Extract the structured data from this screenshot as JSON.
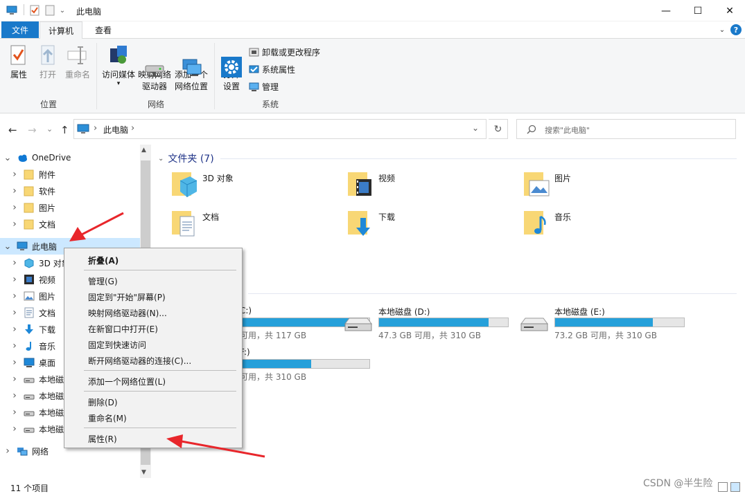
{
  "window": {
    "title": "此电脑",
    "minimize": "—",
    "maximize": "☐",
    "close": "✕"
  },
  "ribbon_tabs": [
    {
      "label": "文件"
    },
    {
      "label": "计算机"
    },
    {
      "label": "查看"
    }
  ],
  "ribbon": {
    "groups": [
      {
        "label": "位置",
        "buttons": [
          "属性",
          "打开",
          "重命名"
        ]
      },
      {
        "label": "网络",
        "buttons": [
          "访问媒体",
          "映射网络\n驱动器",
          "添加一个\n网络位置"
        ]
      },
      {
        "label": "系统",
        "buttons": [
          "打开\n设置"
        ],
        "small": [
          "卸载或更改程序",
          "系统属性",
          "管理"
        ]
      }
    ],
    "media_dropdown": "▾",
    "map_dropdown": "▾"
  },
  "nav": {
    "back": "←",
    "forward": "→",
    "recent": "⌄",
    "up": "↑",
    "address": "此电脑",
    "address_sep": "›",
    "address_dropdown": "⌄",
    "refresh": "↻",
    "search_placeholder": "搜索\"此电脑\""
  },
  "tree": [
    {
      "label": "OneDrive",
      "icon": "cloud-icon",
      "level": 0,
      "expanded": true
    },
    {
      "label": "附件",
      "icon": "folder-icon",
      "level": 1
    },
    {
      "label": "软件",
      "icon": "folder-icon",
      "level": 1
    },
    {
      "label": "图片",
      "icon": "folder-icon",
      "level": 1
    },
    {
      "label": "文档",
      "icon": "folder-icon",
      "level": 1
    },
    {
      "label": "此电脑",
      "icon": "computer-icon",
      "level": 0,
      "expanded": true,
      "selected": true
    },
    {
      "label": "3D 对象",
      "icon": "3d-objects-icon",
      "level": 1
    },
    {
      "label": "视频",
      "icon": "video-icon",
      "level": 1
    },
    {
      "label": "图片",
      "icon": "pictures-icon",
      "level": 1
    },
    {
      "label": "文档",
      "icon": "documents-icon",
      "level": 1
    },
    {
      "label": "下载",
      "icon": "download-icon",
      "level": 1
    },
    {
      "label": "音乐",
      "icon": "music-icon",
      "level": 1
    },
    {
      "label": "桌面",
      "icon": "desktop-icon",
      "level": 1
    },
    {
      "label": "本地磁盘",
      "icon": "drive-icon",
      "level": 1
    },
    {
      "label": "本地磁盘",
      "icon": "drive-icon",
      "level": 1
    },
    {
      "label": "本地磁盘",
      "icon": "drive-icon",
      "level": 1
    },
    {
      "label": "本地磁盘",
      "icon": "drive-icon",
      "level": 1
    },
    {
      "label": "网络",
      "icon": "network-icon",
      "level": 0
    }
  ],
  "content": {
    "folders_header": "文件夹 (7)",
    "folders": [
      {
        "label": "3D 对象",
        "icon": "3d-objects-folder-icon"
      },
      {
        "label": "视频",
        "icon": "video-folder-icon"
      },
      {
        "label": "图片",
        "icon": "pictures-folder-icon"
      },
      {
        "label": "文档",
        "icon": "documents-folder-icon"
      },
      {
        "label": "下载",
        "icon": "download-folder-icon"
      },
      {
        "label": "音乐",
        "icon": "music-folder-icon"
      }
    ],
    "drives_header_visible": ")",
    "drives": [
      {
        "label": "C:)",
        "free": "可用，共 117 GB",
        "used_fraction": 0.9
      },
      {
        "label": "本地磁盘 (D:)",
        "free": "47.3 GB 可用，共 310 GB",
        "used_fraction": 0.85
      },
      {
        "label": "本地磁盘 (E:)",
        "free": "73.2 GB 可用，共 310 GB",
        "used_fraction": 0.76
      },
      {
        "label": "F:)",
        "free": "可用，共 310 GB",
        "used_fraction": 0.55
      }
    ]
  },
  "context_menu": {
    "items": [
      {
        "label": "折叠(A)",
        "bold": true
      },
      {
        "label": "管理(G)"
      },
      {
        "label": "固定到\"开始\"屏幕(P)"
      },
      {
        "label": "映射网络驱动器(N)..."
      },
      {
        "label": "在新窗口中打开(E)"
      },
      {
        "label": "固定到快速访问"
      },
      {
        "label": "断开网络驱动器的连接(C)..."
      },
      {
        "label": "添加一个网络位置(L)"
      },
      {
        "label": "删除(D)"
      },
      {
        "label": "重命名(M)"
      },
      {
        "label": "属性(R)"
      }
    ]
  },
  "status": {
    "count": "11 个项目"
  },
  "watermark": "CSDN @半生险",
  "colors": {
    "accent": "#1979ca",
    "drive_bar": "#26a0da",
    "selection": "#cce8ff",
    "annotation_arrow": "#e8262b"
  }
}
